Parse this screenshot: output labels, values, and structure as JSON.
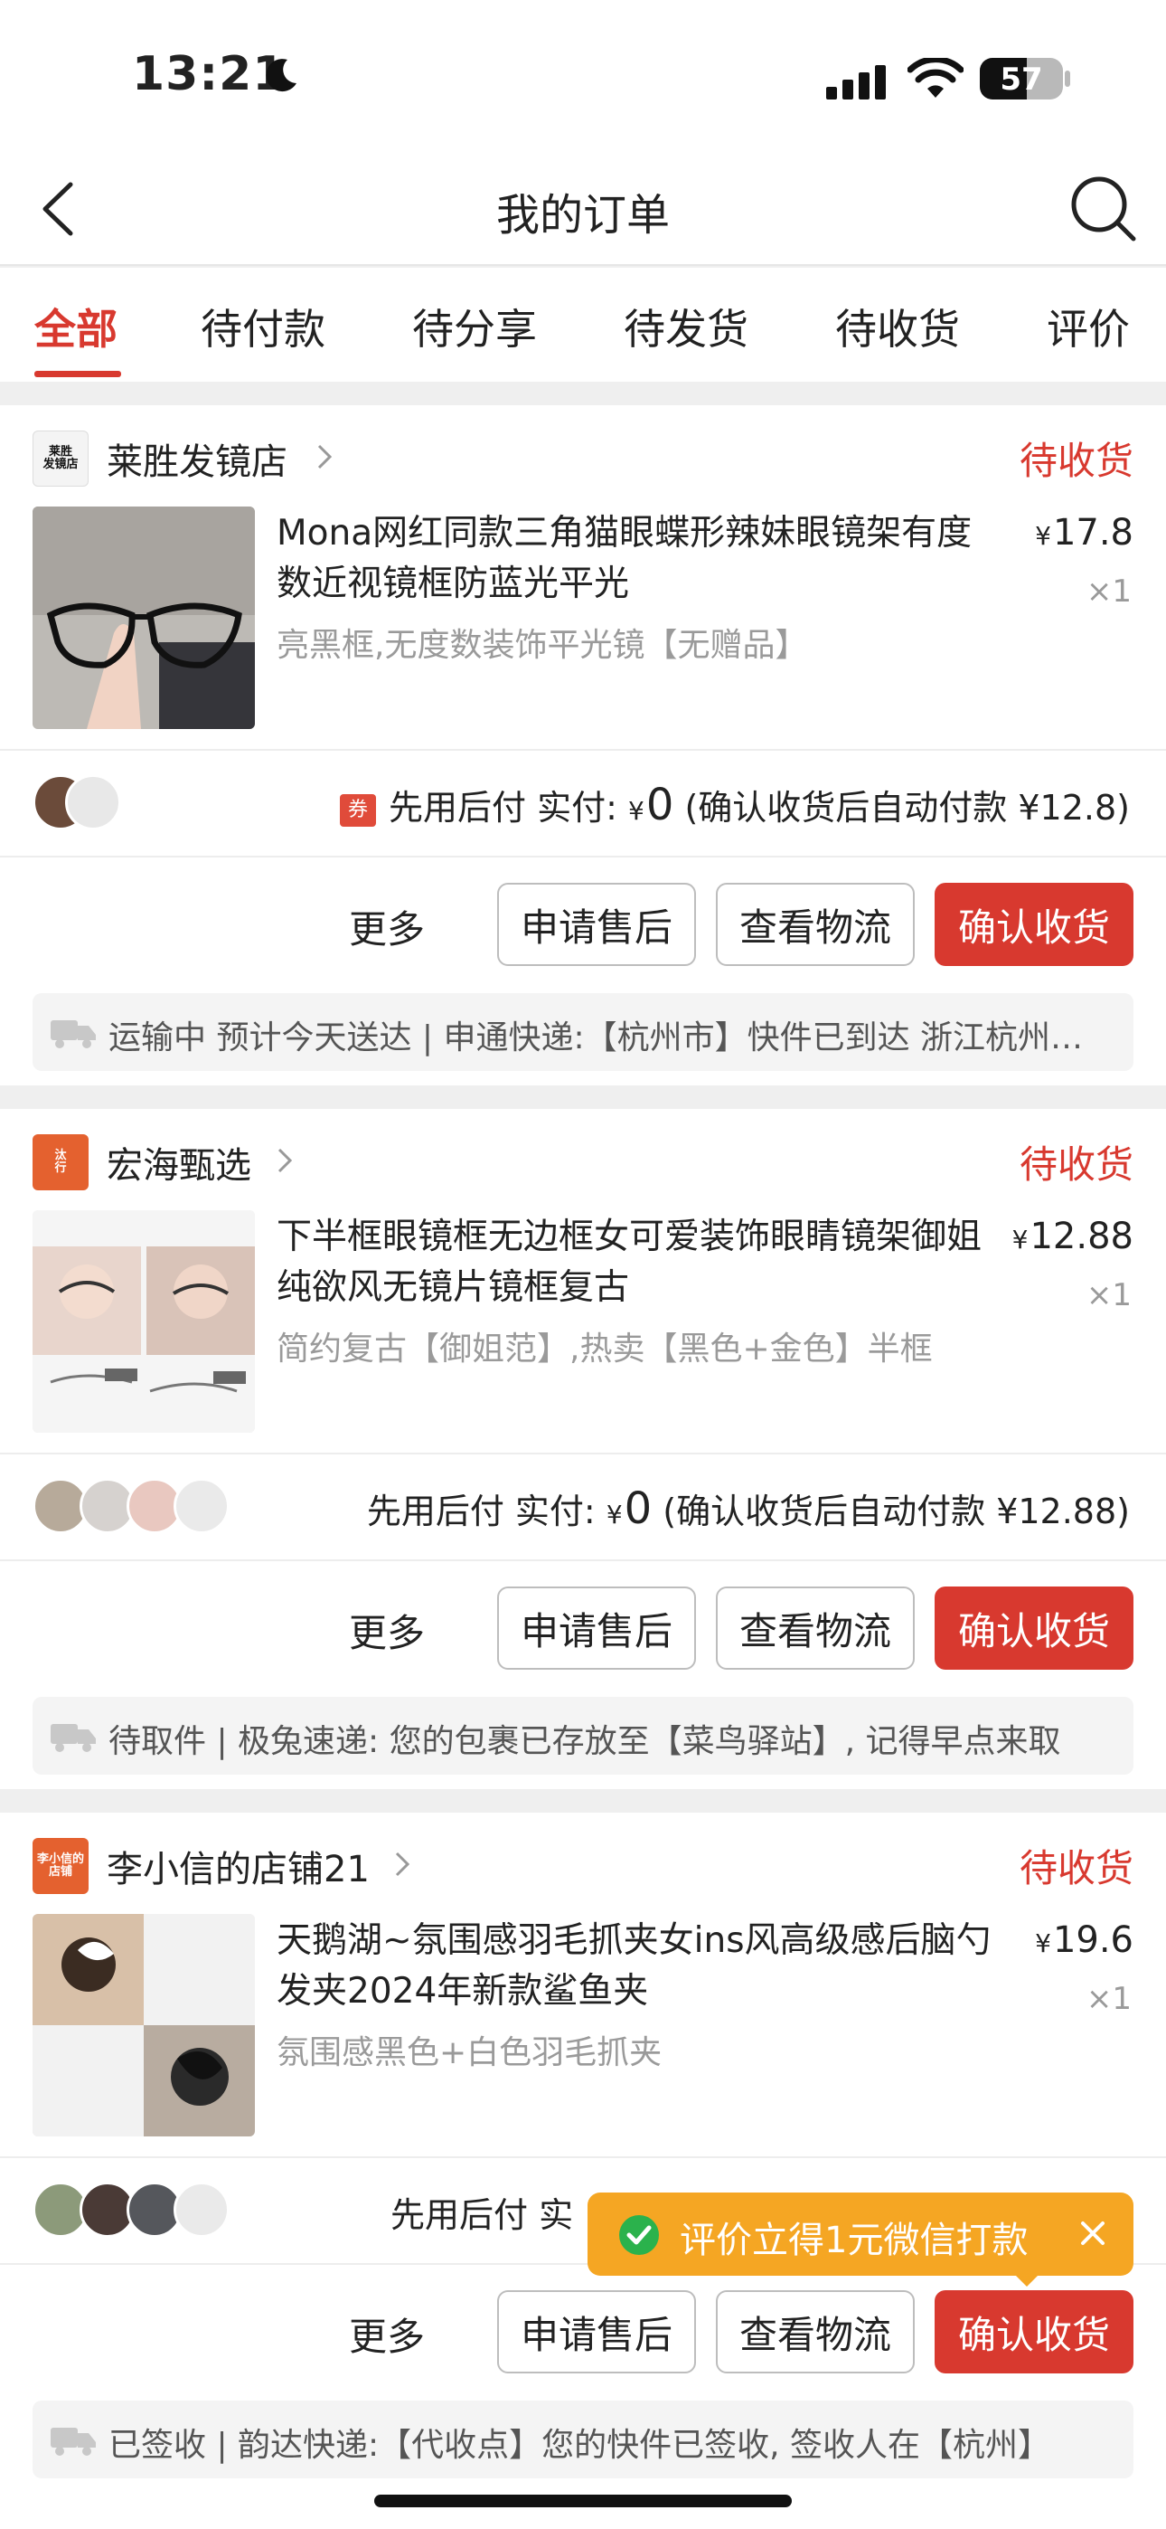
{
  "status_bar": {
    "time": "13:21",
    "battery": "57",
    "battery_level": 0.57
  },
  "nav": {
    "title": "我的订单"
  },
  "tabs": [
    {
      "label": "全部",
      "active": true
    },
    {
      "label": "待付款"
    },
    {
      "label": "待分享"
    },
    {
      "label": "待发货"
    },
    {
      "label": "待收货"
    },
    {
      "label": "评价"
    }
  ],
  "orders": [
    {
      "shop_logo_text": "莱胜\n发镜店",
      "shop_name": "莱胜发镜店",
      "status": "待收货",
      "title": "Mona网红同款三角猫眼蝶形辣妹眼镜架有度数近视镜框防蓝光平光",
      "spec": "亮黑框,无度数装饰平光镜【无赠品】",
      "price_symbol": "¥",
      "price": "17.8",
      "qty": "×1",
      "coupon": "券",
      "pay_label": "先用后付 实付:",
      "pay_symbol": "¥",
      "pay_amount": "0",
      "pay_note": "(确认收货后自动付款 ¥12.8)",
      "more": "更多",
      "btn_after_sale": "申请售后",
      "btn_logistics": "查看物流",
      "btn_confirm": "确认收货",
      "logistics": "运输中 预计今天送达 | 申通快递:【杭州市】快件已到达 浙江杭州转运中心"
    },
    {
      "shop_logo_text": "汰\n行",
      "shop_name": "宏海甄选",
      "status": "待收货",
      "title": "下半框眼镜框无边框女可爱装饰眼睛镜架御姐纯欲风无镜片镜框复古",
      "spec": "简约复古【御姐范】,热卖【黑色+金色】半框",
      "price_symbol": "¥",
      "price": "12.88",
      "qty": "×1",
      "pay_label": "先用后付 实付:",
      "pay_symbol": "¥",
      "pay_amount": "0",
      "pay_note": "(确认收货后自动付款 ¥12.88)",
      "more": "更多",
      "btn_after_sale": "申请售后",
      "btn_logistics": "查看物流",
      "btn_confirm": "确认收货",
      "logistics": "待取件 | 极兔速递: 您的包裹已存放至【菜鸟驿站】, 记得早点来取"
    },
    {
      "shop_logo_text": "李小信的\n店铺",
      "shop_name": "李小信的店铺21",
      "status": "待收货",
      "title": "天鹅湖~氛围感羽毛抓夹女ins风高级感后脑勺发夹2024年新款鲨鱼夹",
      "spec": "氛围感黑色+白色羽毛抓夹",
      "price_symbol": "¥",
      "price": "19.6",
      "qty": "×1",
      "pay_label": "先用后付 实",
      "more": "更多",
      "btn_after_sale": "申请售后",
      "btn_logistics": "查看物流",
      "btn_confirm": "确认收货",
      "logistics": "已签收 | 韵达快递:【代收点】您的快件已签收, 签收人在【杭州】"
    }
  ],
  "tooltip": {
    "text": "评价立得1元微信打款"
  },
  "colors": {
    "accent": "#d8392f",
    "tooltip": "#f5a623"
  }
}
